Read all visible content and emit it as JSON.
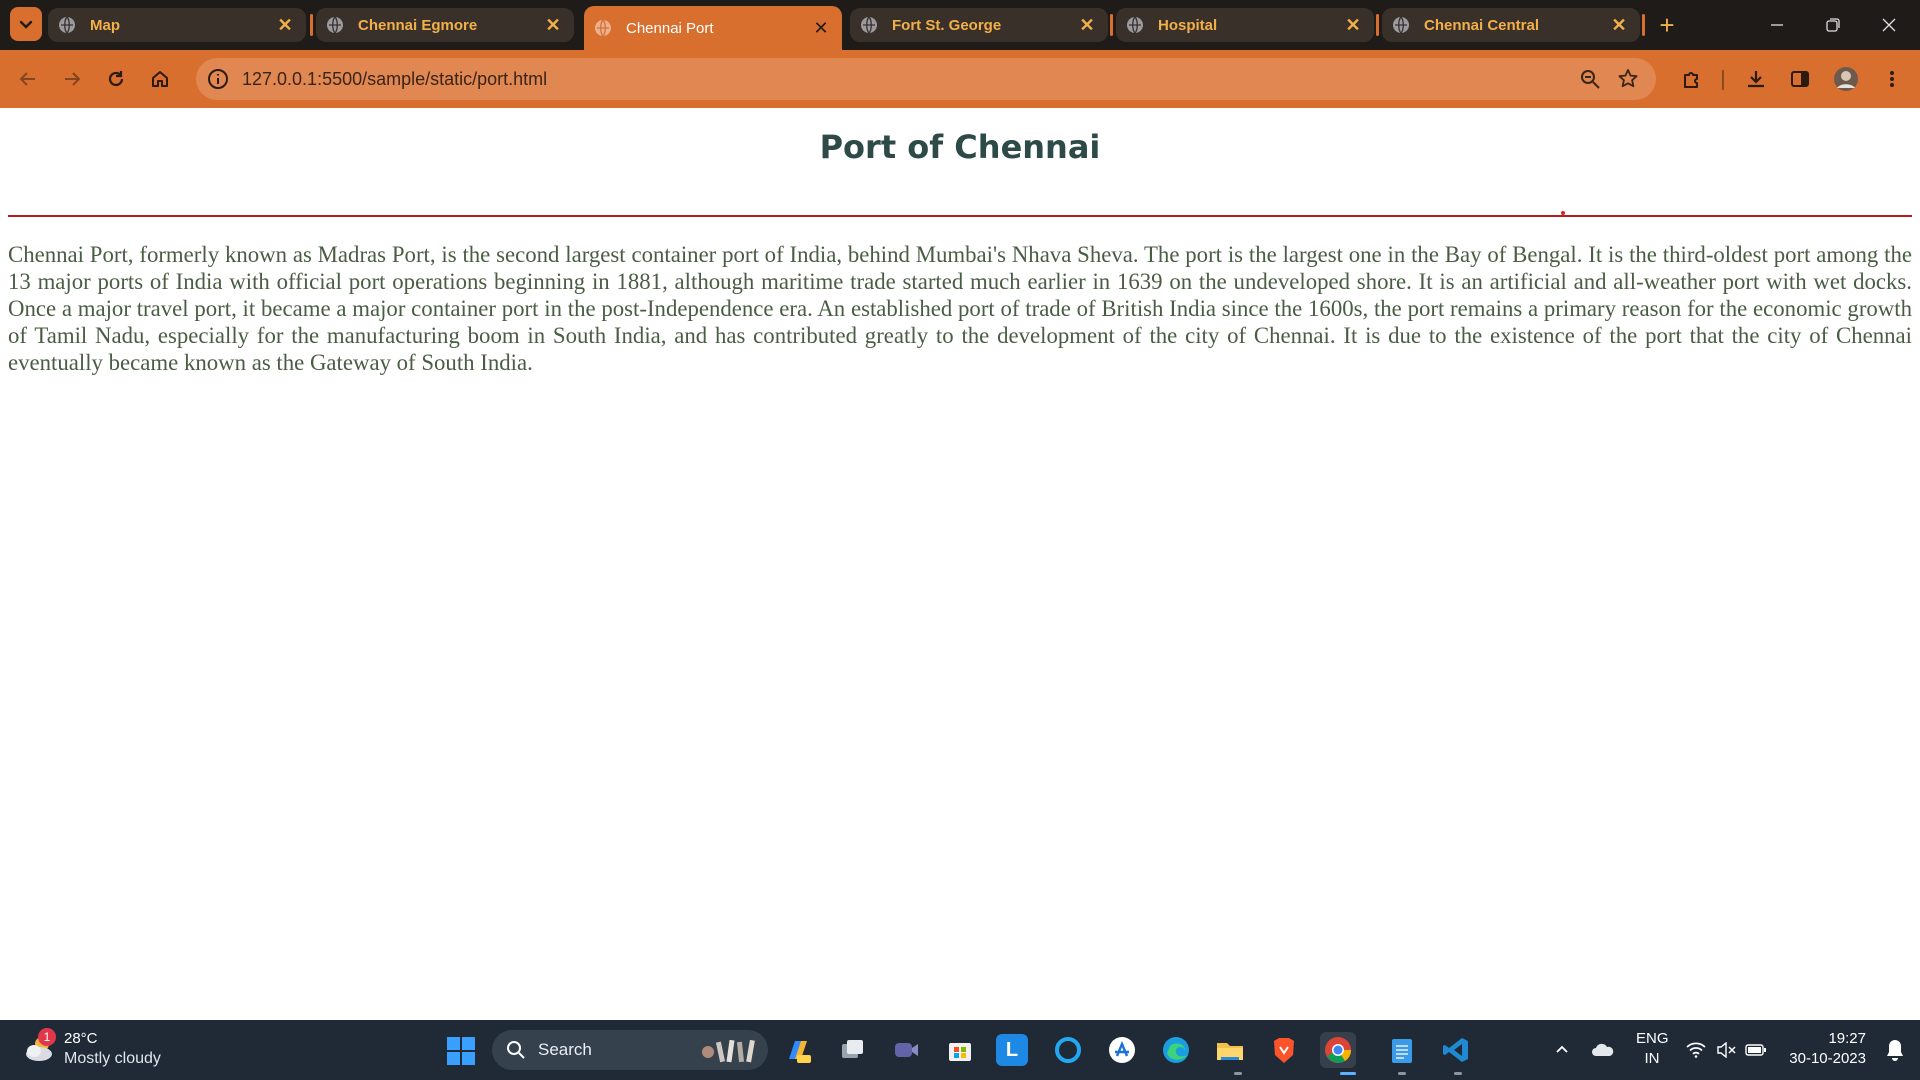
{
  "browser": {
    "tabs": [
      {
        "title": "Map",
        "active": false
      },
      {
        "title": "Chennai Egmore",
        "active": false
      },
      {
        "title": "Chennai Port",
        "active": true
      },
      {
        "title": "Fort St. George",
        "active": false
      },
      {
        "title": "Hospital",
        "active": false
      },
      {
        "title": "Chennai Central",
        "active": false
      }
    ],
    "address": "127.0.0.1:5500/sample/static/port.html",
    "accent_color": "#d96f2e",
    "tab_text_color": "#f2b04a"
  },
  "page": {
    "heading": "Port of Chennai",
    "paragraph": "Chennai Port, formerly known as Madras Port, is the second largest container port of India, behind Mumbai's Nhava Sheva. The port is the largest one in the Bay of Bengal. It is the third-oldest port among the 13 major ports of India with official port operations beginning in 1881, although maritime trade started much earlier in 1639 on the undeveloped shore. It is an artificial and all-weather port with wet docks. Once a major travel port, it became a major container port in the post-Independence era. An established port of trade of British India since the 1600s, the port remains a primary reason for the economic growth of Tamil Nadu, especially for the manufacturing boom in South India, and has contributed greatly to the development of the city of Chennai. It is due to the existence of the port that the city of Chennai eventually became known as the Gateway of South India.",
    "rule_color": "#b81e1e"
  },
  "taskbar": {
    "weather": {
      "badge": "1",
      "temperature": "28°C",
      "condition": "Mostly cloudy"
    },
    "search_label": "Search",
    "apps": [
      "copilot-icon",
      "task-view-icon",
      "teams-icon",
      "microsoft-store-icon",
      "l-app-icon",
      "cortana-icon",
      "app-store-icon",
      "edge-icon",
      "file-explorer-icon",
      "brave-icon",
      "chrome-icon",
      "notepad-icon",
      "vscode-icon"
    ],
    "language": {
      "line1": "ENG",
      "line2": "IN"
    },
    "clock": {
      "time": "19:27",
      "date": "30-10-2023"
    }
  }
}
